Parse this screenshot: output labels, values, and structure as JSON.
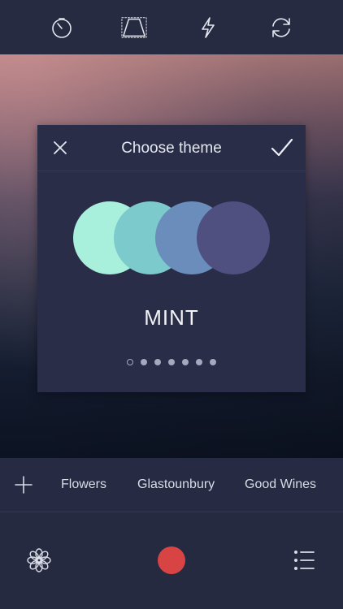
{
  "toolbar": {
    "icons": [
      "timer-icon",
      "perspective-icon",
      "flash-icon",
      "switch-camera-icon"
    ]
  },
  "modal": {
    "title": "Choose theme",
    "theme_name": "MINT",
    "page_count": 7,
    "active_page": 1,
    "swatch_colors": [
      "#a8efdc",
      "#7ccacb",
      "#6a8dbb",
      "#4f4f80"
    ]
  },
  "tags": {
    "items": [
      "Flowers",
      "Glastounbury",
      "Good Wines"
    ]
  },
  "bottom": {
    "record_color": "#d84444",
    "icons": [
      "flower-icon",
      "record-button",
      "list-icon"
    ]
  }
}
